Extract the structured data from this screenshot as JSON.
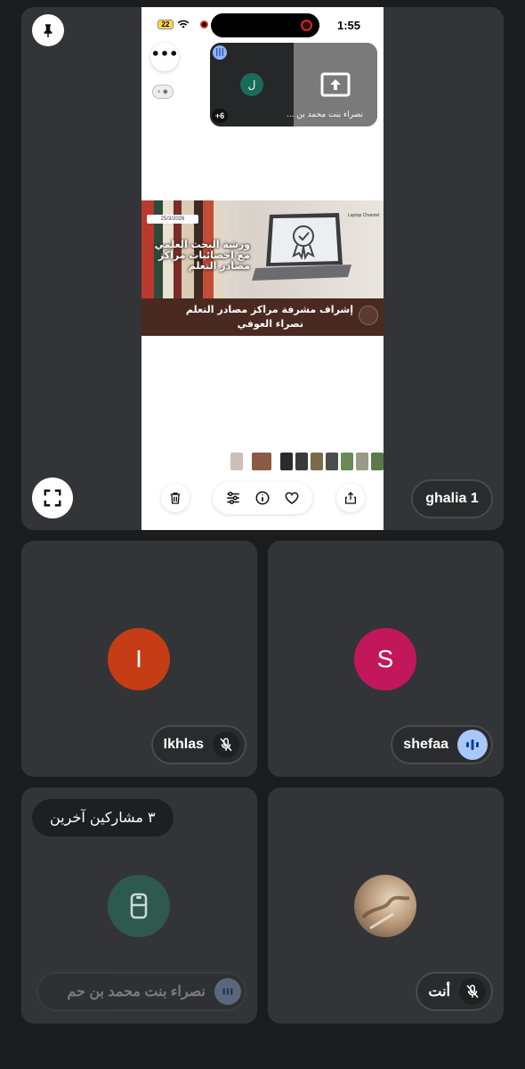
{
  "status_bar": {
    "battery": "22",
    "time": "1:55"
  },
  "main_tile": {
    "participant_name": "ghalia 1",
    "pin_icon": "pin-icon",
    "fullscreen_icon": "fullscreen-icon"
  },
  "shared_screen": {
    "more_button": "•••",
    "mini_call": {
      "avatar_letter": "ل",
      "count_badge": "+6",
      "participant_name": "نصراء بنت محمد بن ..."
    },
    "poster": {
      "date": "25/3/2026",
      "title": "ورشة البحث العلمي مع اخصائيات مراكز مصادر التعلم",
      "supervisor_line": "إشراف مشرفة مراكز مصادر التعلم",
      "supervisor_name": "نصراء العوفي",
      "laptop_brand": "Laptop Channel"
    },
    "toolbar_icons": [
      "trash-icon",
      "adjust-icon",
      "info-icon",
      "heart-icon",
      "share-icon"
    ]
  },
  "participants": [
    {
      "name": "Ikhlas",
      "initial": "I",
      "avatar_color": "#c53d15",
      "mic": "muted"
    },
    {
      "name": "shefaa",
      "initial": "S",
      "avatar_color": "#c2185b",
      "mic": "speaking"
    },
    {
      "name": "نصراء بنت محمد بن حم",
      "others_label": "٣ مشاركين آخرين",
      "avatar_color": "#2e5a4e"
    },
    {
      "name": "أنت",
      "mic": "muted"
    }
  ],
  "colors": {
    "background": "#1b1c1e",
    "tile": "#333437",
    "speaking_accent": "#a8c7fa"
  }
}
